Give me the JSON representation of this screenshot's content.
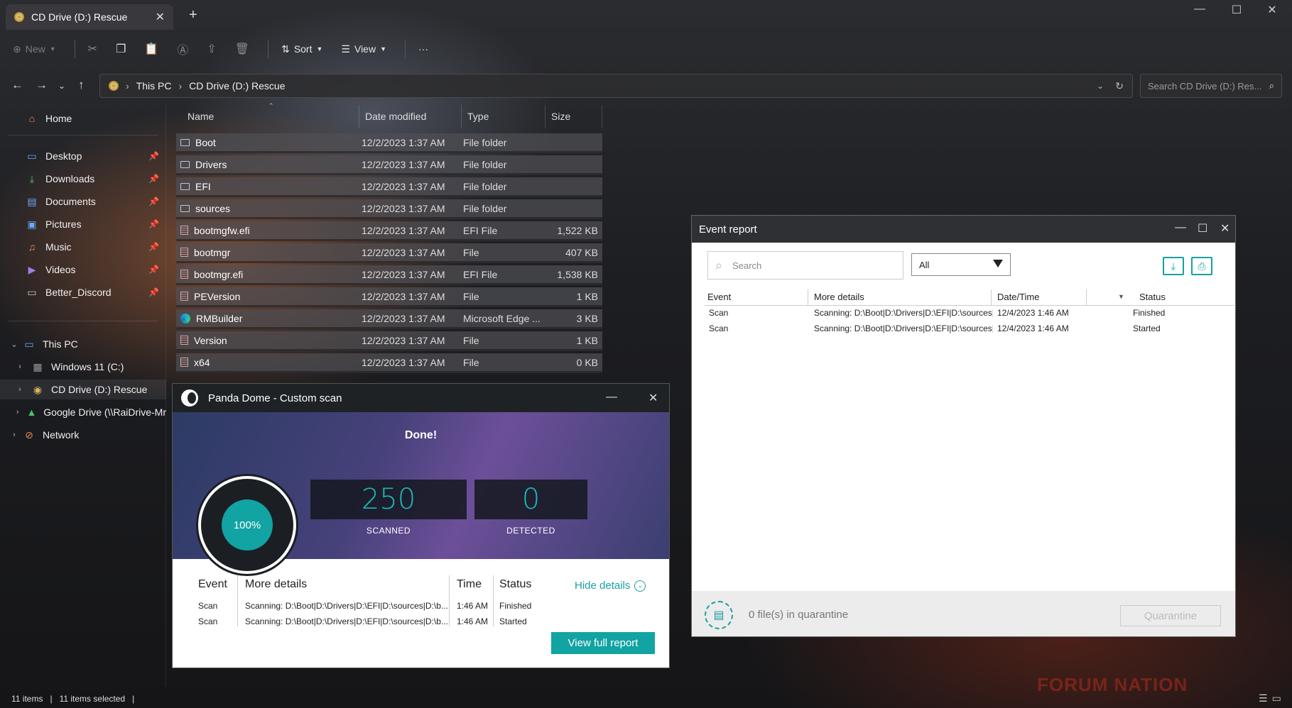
{
  "window": {
    "tab_title": "CD Drive (D:) Rescue",
    "tab_close": "✕",
    "new_tab": "+",
    "minimize": "—",
    "maximize": "☐",
    "close": "✕"
  },
  "toolbar": {
    "new_label": "New",
    "sort_label": "Sort",
    "view_label": "View",
    "more_label": "···"
  },
  "address": {
    "crumbs": [
      "This PC",
      "CD Drive (D:) Rescue"
    ],
    "search_placeholder": "Search CD Drive (D:) Res..."
  },
  "sidebar": {
    "home": "Home",
    "quick": [
      {
        "label": "Desktop",
        "icon": "desktop-icon"
      },
      {
        "label": "Downloads",
        "icon": "download-icon"
      },
      {
        "label": "Documents",
        "icon": "documents-icon"
      },
      {
        "label": "Pictures",
        "icon": "pictures-icon"
      },
      {
        "label": "Music",
        "icon": "music-icon"
      },
      {
        "label": "Videos",
        "icon": "videos-icon"
      },
      {
        "label": "Better_Discord",
        "icon": "folder-icon"
      }
    ],
    "this_pc": "This PC",
    "drives": [
      {
        "label": "Windows 11 (C:)"
      },
      {
        "label": "CD Drive (D:) Rescue"
      },
      {
        "label": "Google Drive (\\\\RaiDrive-Mr"
      }
    ],
    "network": "Network"
  },
  "files": {
    "columns": [
      "Name",
      "Date modified",
      "Type",
      "Size"
    ],
    "rows": [
      {
        "name": "Boot",
        "date": "12/2/2023 1:37 AM",
        "type": "File folder",
        "size": "",
        "kind": "folder"
      },
      {
        "name": "Drivers",
        "date": "12/2/2023 1:37 AM",
        "type": "File folder",
        "size": "",
        "kind": "folder"
      },
      {
        "name": "EFI",
        "date": "12/2/2023 1:37 AM",
        "type": "File folder",
        "size": "",
        "kind": "folder"
      },
      {
        "name": "sources",
        "date": "12/2/2023 1:37 AM",
        "type": "File folder",
        "size": "",
        "kind": "folder"
      },
      {
        "name": "bootmgfw.efi",
        "date": "12/2/2023 1:37 AM",
        "type": "EFI File",
        "size": "1,522 KB",
        "kind": "file"
      },
      {
        "name": "bootmgr",
        "date": "12/2/2023 1:37 AM",
        "type": "File",
        "size": "407 KB",
        "kind": "file"
      },
      {
        "name": "bootmgr.efi",
        "date": "12/2/2023 1:37 AM",
        "type": "EFI File",
        "size": "1,538 KB",
        "kind": "file"
      },
      {
        "name": "PEVersion",
        "date": "12/2/2023 1:37 AM",
        "type": "File",
        "size": "1 KB",
        "kind": "file"
      },
      {
        "name": "RMBuilder",
        "date": "12/2/2023 1:37 AM",
        "type": "Microsoft Edge ...",
        "size": "3 KB",
        "kind": "edge"
      },
      {
        "name": "Version",
        "date": "12/2/2023 1:37 AM",
        "type": "File",
        "size": "1 KB",
        "kind": "file"
      },
      {
        "name": "x64",
        "date": "12/2/2023 1:37 AM",
        "type": "File",
        "size": "0 KB",
        "kind": "file"
      }
    ]
  },
  "status": {
    "count": "11 items",
    "selected": "11 items selected"
  },
  "panda": {
    "title": "Panda Dome - Custom scan",
    "done": "Done!",
    "percent": "100%",
    "scanned_value": "250",
    "scanned_label": "SCANNED",
    "detected_value": "0",
    "detected_label": "DETECTED",
    "headers": {
      "event": "Event",
      "details": "More details",
      "time": "Time",
      "status": "Status"
    },
    "rows": [
      {
        "event": "Scan",
        "details": "Scanning: D:\\Boot|D:\\Drivers|D:\\EFI|D:\\sources|D:\\b...",
        "time": "1:46 AM",
        "status": "Finished"
      },
      {
        "event": "Scan",
        "details": "Scanning: D:\\Boot|D:\\Drivers|D:\\EFI|D:\\sources|D:\\b...",
        "time": "1:46 AM",
        "status": "Started"
      }
    ],
    "hide_details": "Hide details",
    "view_full_report": "View full report",
    "accent": "#12a3a3"
  },
  "event_report": {
    "title": "Event report",
    "search_placeholder": "Search",
    "filter_value": "All",
    "headers": {
      "event": "Event",
      "details": "More details",
      "datetime": "Date/Time",
      "status": "Status"
    },
    "rows": [
      {
        "event": "Scan",
        "details": "Scanning: D:\\Boot|D:\\Drivers|D:\\EFI|D:\\sources|D:\\bo...",
        "datetime": "12/4/2023 1:46 AM",
        "status": "Finished"
      },
      {
        "event": "Scan",
        "details": "Scanning: D:\\Boot|D:\\Drivers|D:\\EFI|D:\\sources|D:\\bo...",
        "datetime": "12/4/2023 1:46 AM",
        "status": "Started"
      }
    ],
    "quarantine_text": "0 file(s) in quarantine",
    "quarantine_button": "Quarantine"
  },
  "wallpaper": {
    "watermark": "FORUM NATION"
  }
}
